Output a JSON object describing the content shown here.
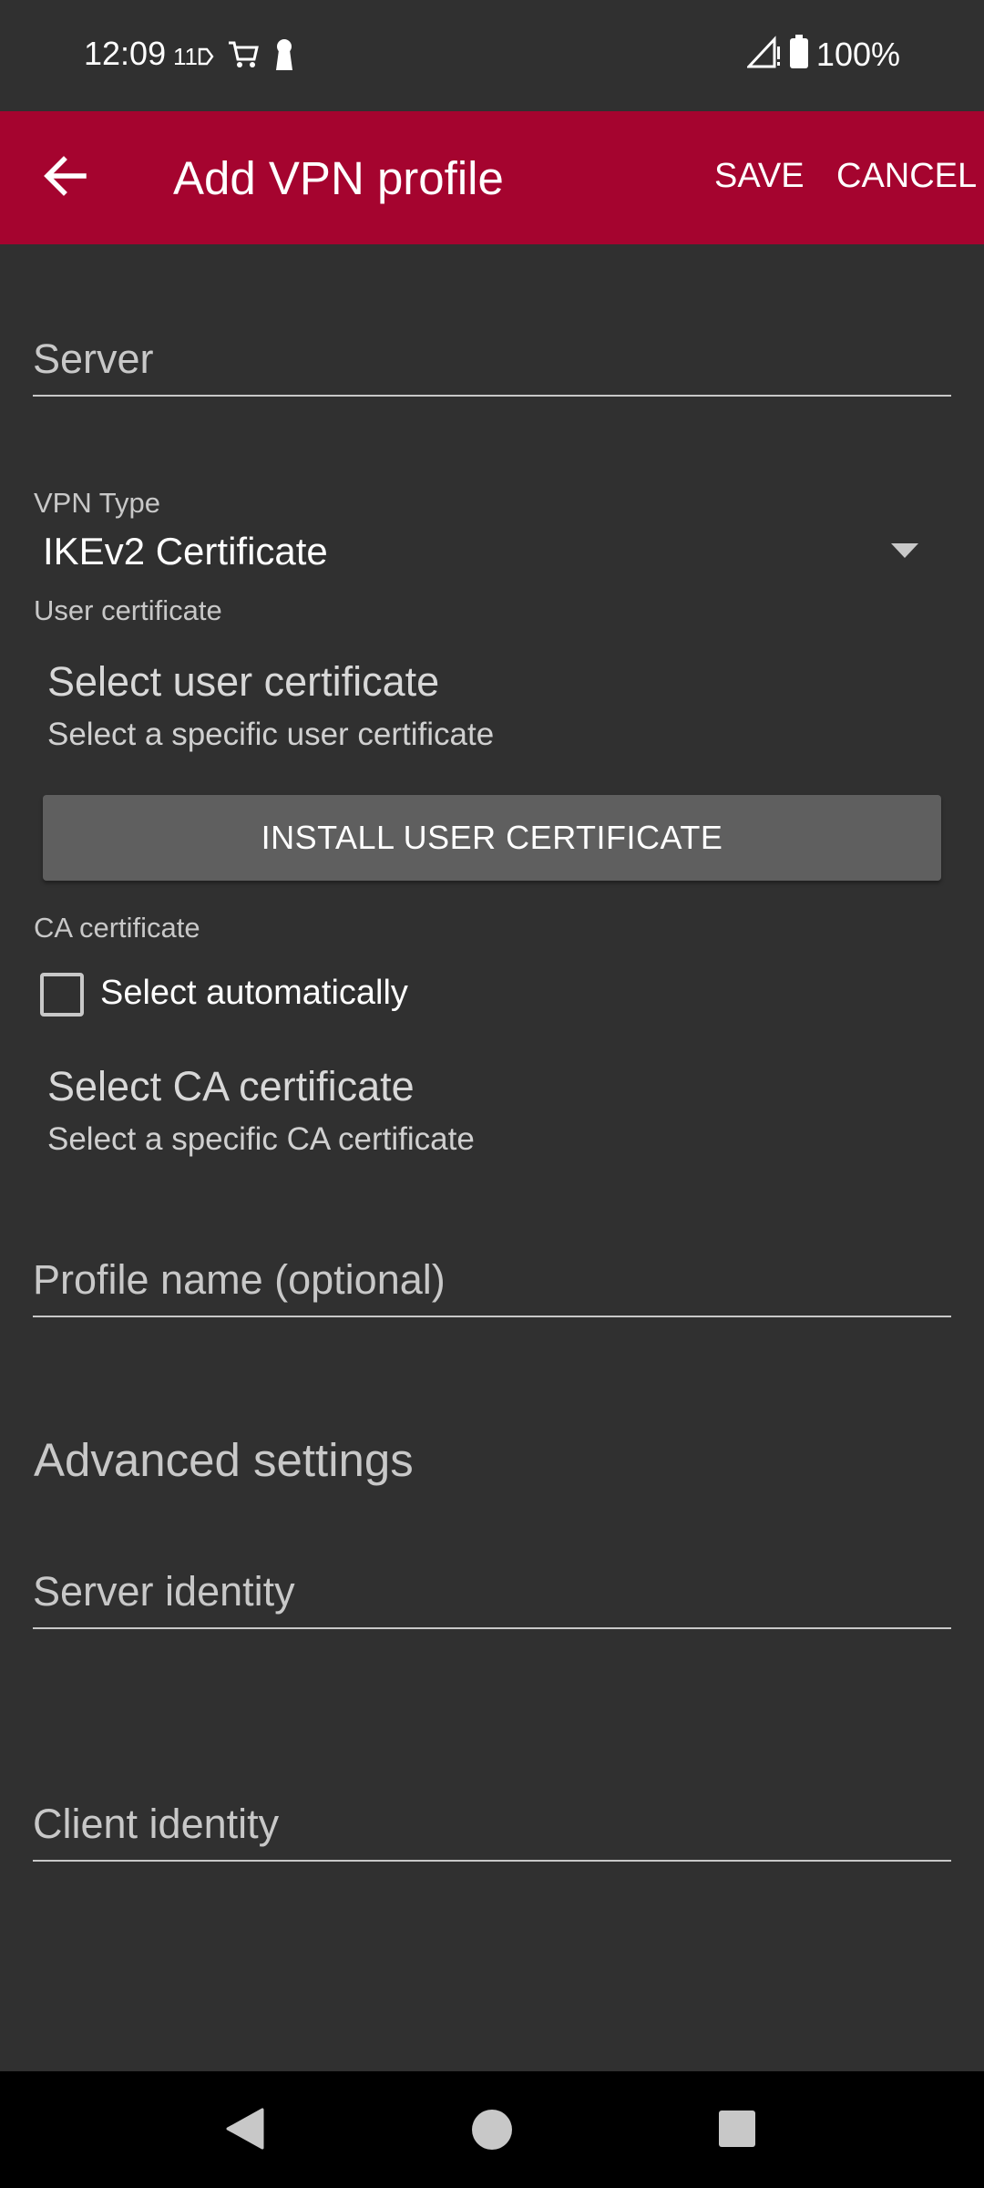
{
  "status_bar": {
    "time": "12:09",
    "notification_badge": "11",
    "battery": "100%",
    "icons": [
      "shopping-cart-icon",
      "keyhole-icon",
      "signal-icon",
      "battery-icon"
    ]
  },
  "app_bar": {
    "title": "Add VPN profile",
    "save_label": "SAVE",
    "cancel_label": "CANCEL",
    "color": "#a5042f"
  },
  "form": {
    "server_placeholder": "Server",
    "vpn_type_label": "VPN Type",
    "vpn_type_value": "IKEv2 Certificate",
    "user_certificate_label": "User certificate",
    "select_user_cert_title": "Select user certificate",
    "select_user_cert_sub": "Select a specific user certificate",
    "install_button": "INSTALL USER CERTIFICATE",
    "ca_certificate_label": "CA certificate",
    "select_auto_label": "Select automatically",
    "select_auto_checked": false,
    "select_ca_title": "Select CA certificate",
    "select_ca_sub": "Select a specific CA certificate",
    "profile_name_placeholder": "Profile name (optional)",
    "advanced_settings": "Advanced settings",
    "server_identity_placeholder": "Server identity",
    "client_identity_placeholder": "Client identity"
  },
  "nav_bar": {
    "icons": [
      "back-triangle-icon",
      "home-circle-icon",
      "recents-square-icon"
    ]
  }
}
